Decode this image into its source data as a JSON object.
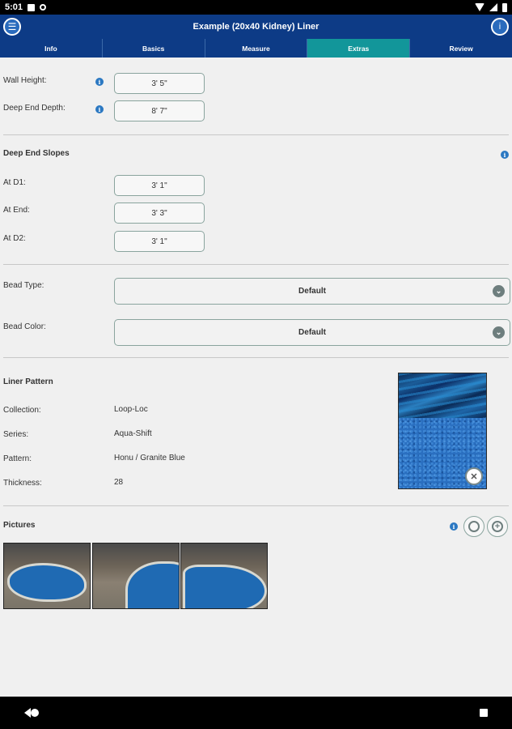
{
  "status": {
    "time": "5:01"
  },
  "header": {
    "title": "Example (20x40 Kidney) Liner",
    "menu_icon": "menu-icon",
    "info_icon": "info-icon"
  },
  "tabs": [
    {
      "label": "Info",
      "active": false
    },
    {
      "label": "Basics",
      "active": false
    },
    {
      "label": "Measure",
      "active": false
    },
    {
      "label": "Extras",
      "active": true
    },
    {
      "label": "Review",
      "active": false
    }
  ],
  "dimensions": {
    "wall_height": {
      "label": "Wall Height:",
      "value": "3' 5\""
    },
    "deep_end_depth": {
      "label": "Deep End Depth:",
      "value": "8' 7\""
    }
  },
  "slopes": {
    "title": "Deep End Slopes",
    "d1": {
      "label": "At D1:",
      "value": "3' 1\""
    },
    "end": {
      "label": "At End:",
      "value": "3' 3\""
    },
    "d2": {
      "label": "At D2:",
      "value": "3' 1\""
    }
  },
  "bead": {
    "type": {
      "label": "Bead Type:",
      "value": "Default"
    },
    "color": {
      "label": "Bead Color:",
      "value": "Default"
    }
  },
  "liner": {
    "title": "Liner Pattern",
    "collection": {
      "label": "Collection:",
      "value": "Loop-Loc"
    },
    "series": {
      "label": "Series:",
      "value": "Aqua-Shift"
    },
    "pattern": {
      "label": "Pattern:",
      "value": "Honu / Granite Blue"
    },
    "thickness": {
      "label": "Thickness:",
      "value": "28"
    }
  },
  "pictures": {
    "title": "Pictures"
  },
  "colors": {
    "header": "#0d3b86",
    "active_tab": "#12969a",
    "info_icon": "#2b78c2"
  }
}
